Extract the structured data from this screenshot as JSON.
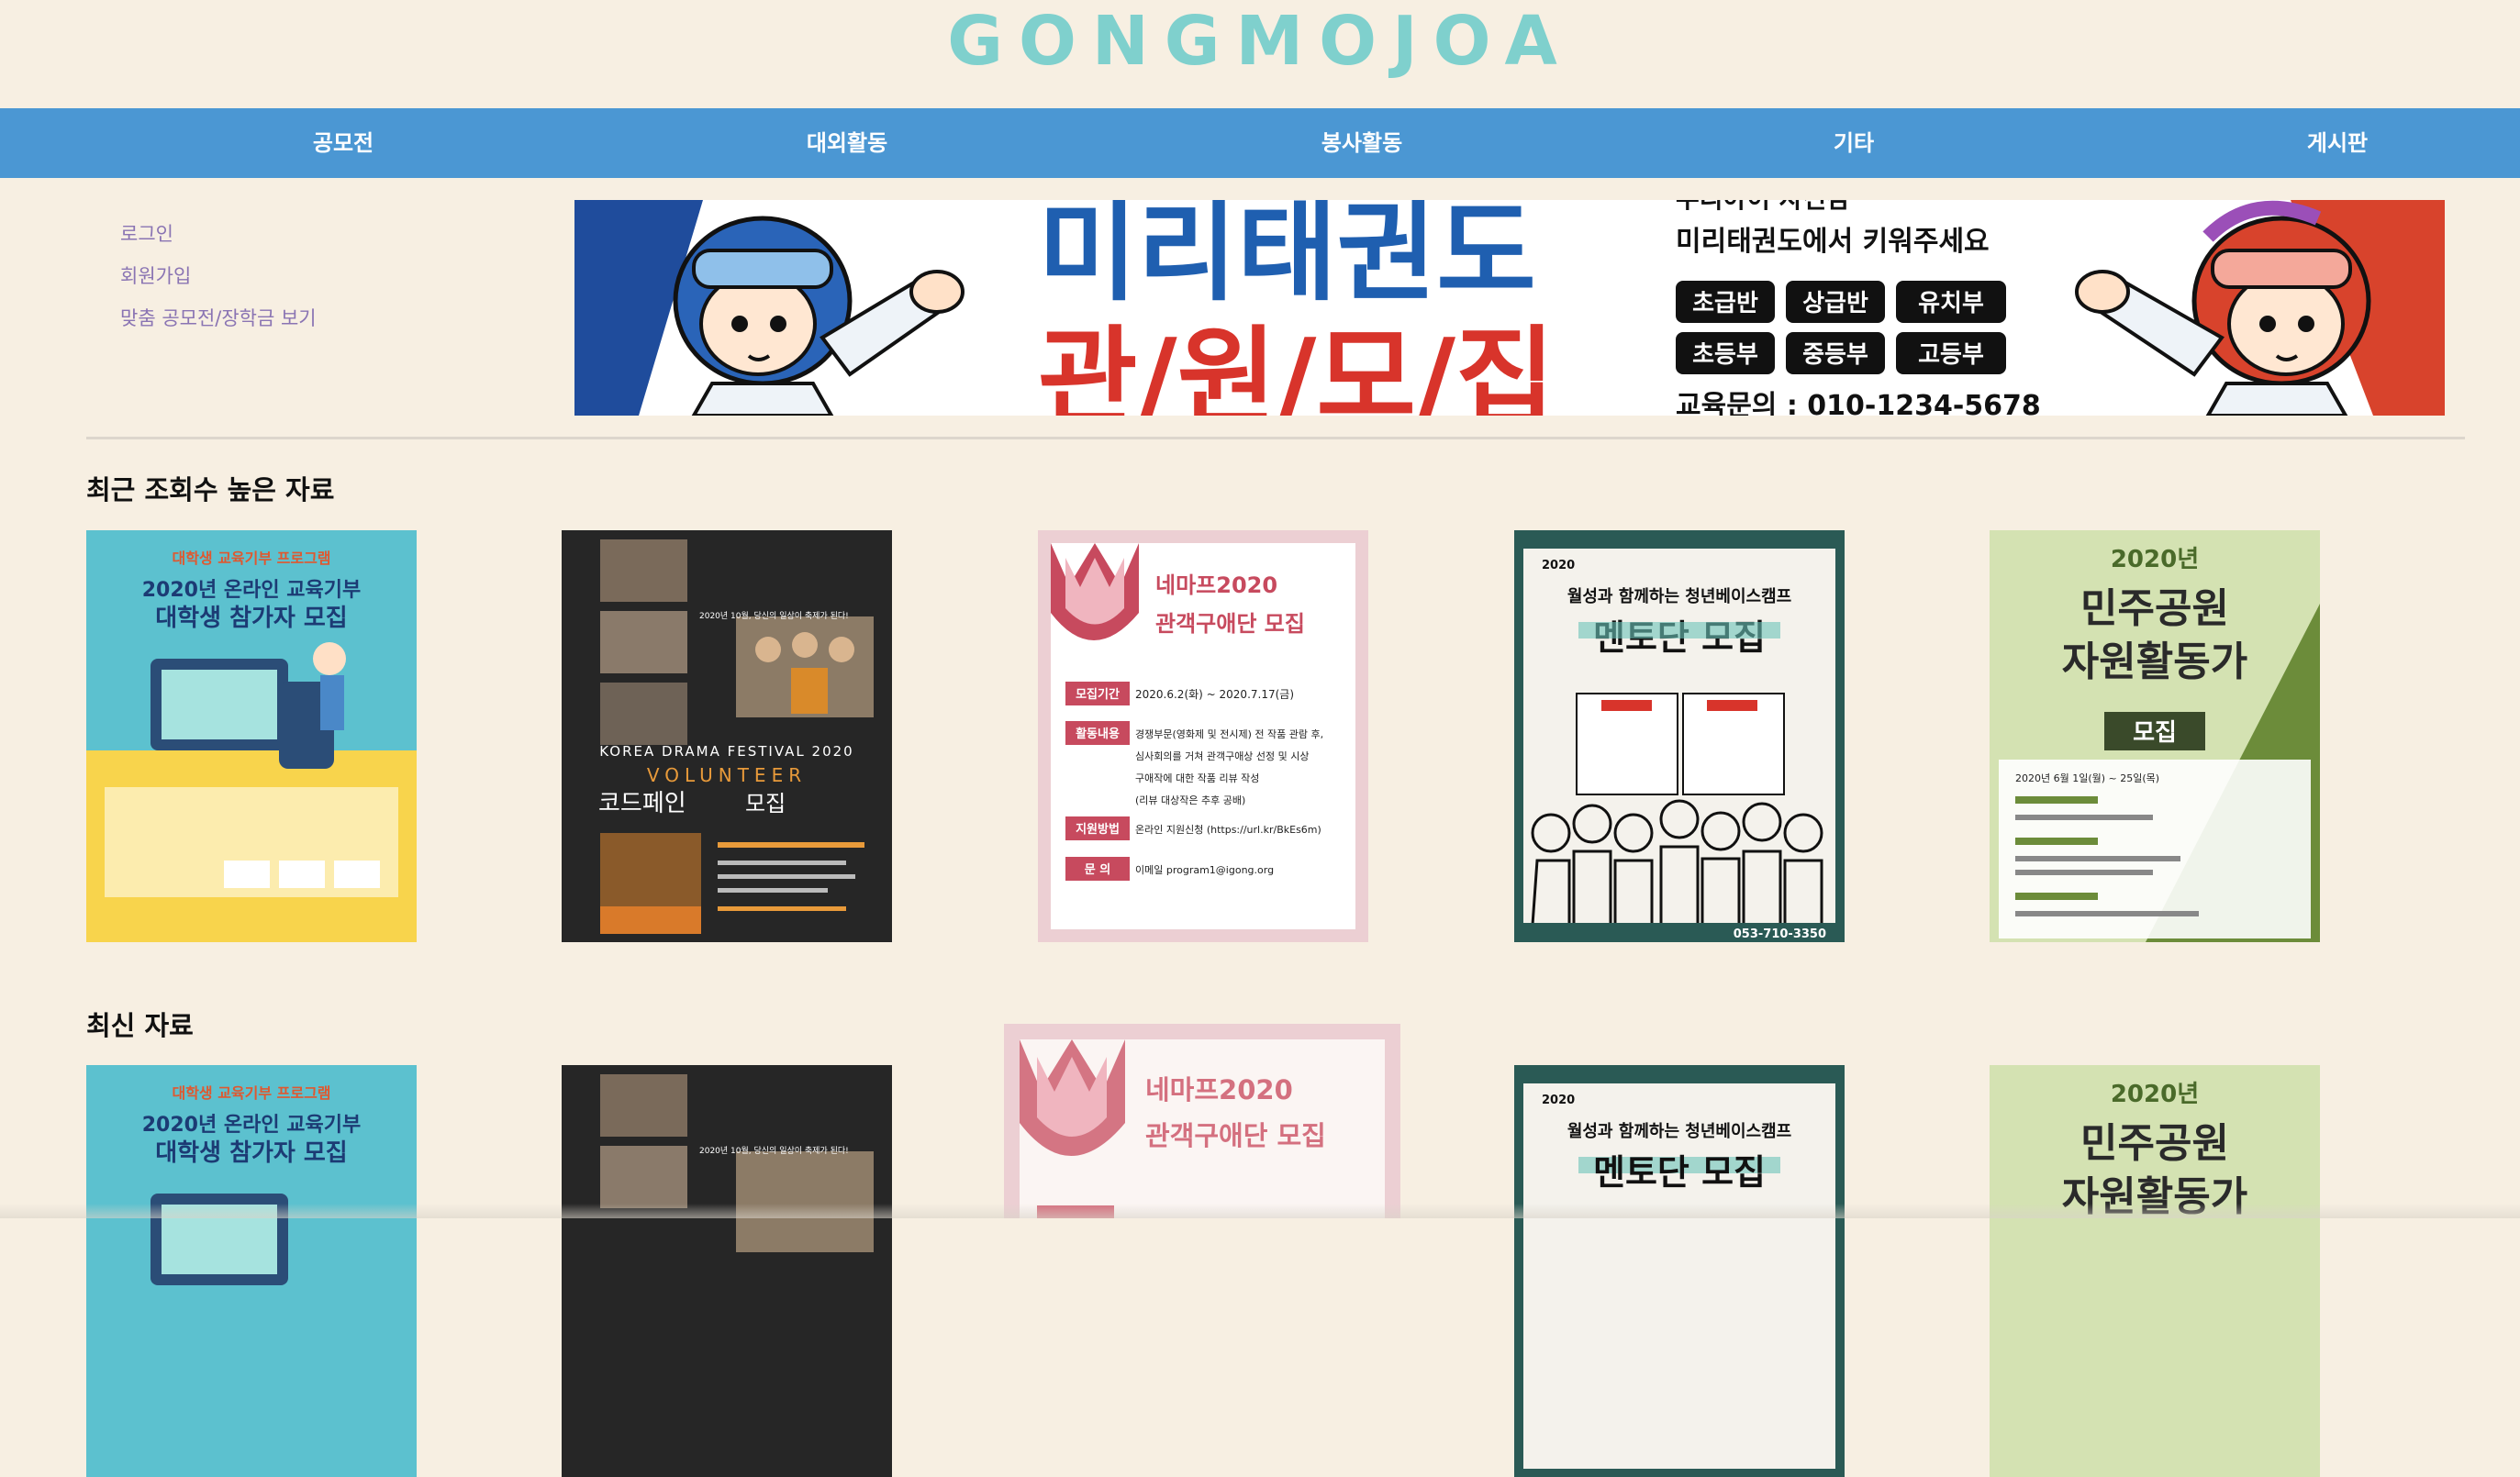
{
  "site": {
    "logo": "GONGMOJOA"
  },
  "nav": {
    "items": [
      {
        "label": "공모전"
      },
      {
        "label": "대외활동"
      },
      {
        "label": "봉사활동"
      },
      {
        "label": "기타"
      },
      {
        "label": "게시판"
      }
    ]
  },
  "sidebar": {
    "links": [
      {
        "label": "로그인"
      },
      {
        "label": "회원가입"
      },
      {
        "label": "맞춤 공모전/장학금 보기"
      }
    ]
  },
  "banner": {
    "title": "미리태권도",
    "recruit": "관/원/모/집",
    "tagline_top": "우리아이 자신감",
    "tagline": "미리태권도에서 키워주세요",
    "classes": [
      "초급반",
      "상급반",
      "유치부",
      "초등부",
      "중등부",
      "고등부"
    ],
    "contact": "교육문의 : 010-1234-5678"
  },
  "sections": {
    "popular_title": "최근 조회수 높은 자료",
    "latest_title": "최신 자료"
  },
  "posters": {
    "edu": {
      "top": "대학생 교육기부 프로그램",
      "line1": "2020년 온라인 교육기부",
      "line2": "대학생 참가자 모집"
    },
    "drama": {
      "headline": "2020년 10월, 당신의 일상이 축제가 된다!",
      "en": "KOREA DRAMA FESTIVAL  2020",
      "vol": "VOLUNTEER",
      "title": "코드페인",
      "title2": "모집"
    },
    "nemaf": {
      "title1": "네마프2020",
      "title2": "관객구애단 모집",
      "rows": [
        {
          "label": "모집기간",
          "text": "2020.6.2(화) ~ 2020.7.17(금)"
        },
        {
          "label": "활동내용",
          "text": "경쟁부문(영화제 및 전시제) 전 작품 관람 후,"
        },
        {
          "label": "",
          "text": "심사회의를 거쳐 관객구애상 선정 및 시상"
        },
        {
          "label": "",
          "text": "구애작에 대한 작품 리뷰 작성"
        },
        {
          "label": "",
          "text": "(리뷰 대상작은 추후 공배)"
        },
        {
          "label": "지원방법",
          "text": "온라인 지원신청 (https://url.kr/BkEs6m)"
        },
        {
          "label": "문 의",
          "text": "이메일 program1@igong.org"
        }
      ]
    },
    "mentor": {
      "year": "2020",
      "top": "월성과 함께하는 청년베이스캠프",
      "title": "멘토단 모집",
      "phone": "053-710-3350"
    },
    "democracy": {
      "year": "2020년",
      "line1": "민주공원",
      "line2": "자원활동가",
      "badge": "모집",
      "info": "2020년 6월 1일(월) ~ 25일(목)"
    }
  },
  "colors": {
    "background": "#f7efe2",
    "nav": "#4b97d3",
    "logo": "#7fd0cd",
    "side_link": "#8a74b3"
  }
}
